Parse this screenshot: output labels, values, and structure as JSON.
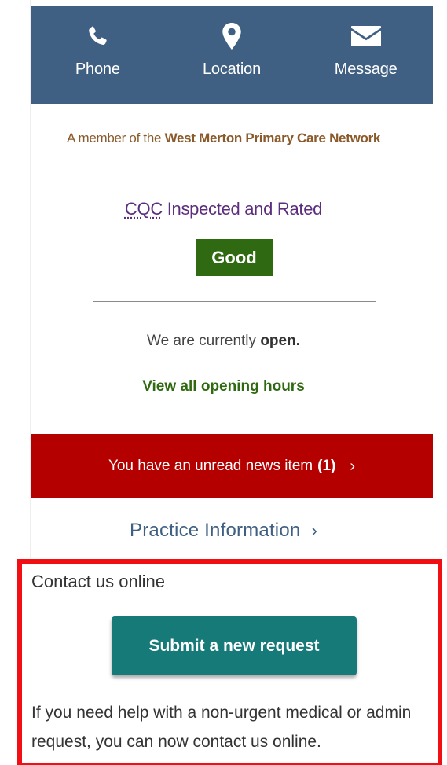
{
  "contact_bar": {
    "items": [
      {
        "label": "Phone",
        "icon": "phone-icon"
      },
      {
        "label": "Location",
        "icon": "map-pin-icon"
      },
      {
        "label": "Message",
        "icon": "envelope-icon"
      }
    ]
  },
  "membership": {
    "prefix": "A member of the ",
    "network_name": "West Merton Primary Care Network"
  },
  "cqc": {
    "abbr": "CQC",
    "title_rest": " Inspected and Rated",
    "rating": "Good"
  },
  "opening": {
    "status_prefix": "We are currently ",
    "status_value": "open.",
    "hours_link": "View all opening hours"
  },
  "news": {
    "text": "You have an unread news item ",
    "count": "(1)",
    "chevron": "›"
  },
  "practice_info": {
    "label": "Practice Information",
    "chevron": "›"
  },
  "online_contact": {
    "title": "Contact us online",
    "button_label": "Submit a new request",
    "help_text": "If you need help with a non-urgent medical or admin request, you can now contact us online."
  },
  "colors": {
    "contact_bar_bg": "#3f6082",
    "rating_bg": "#2f6a12",
    "news_bg": "#b50000",
    "button_bg": "#167a78",
    "highlight_border": "#f20f14"
  }
}
